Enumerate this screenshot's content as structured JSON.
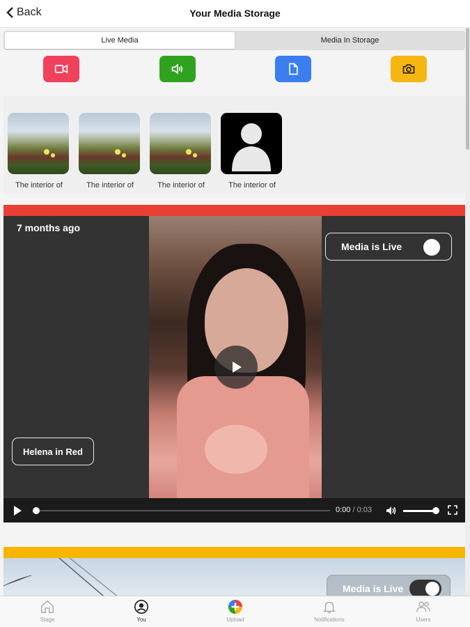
{
  "header": {
    "back_label": "Back",
    "title": "Your Media Storage"
  },
  "segment": {
    "live_label": "Live Media",
    "storage_label": "Media In Storage"
  },
  "media_types": [
    {
      "name": "video",
      "icon": "video-camera-icon",
      "color": "#f0415d"
    },
    {
      "name": "audio",
      "icon": "speaker-icon",
      "color": "#2fa31f"
    },
    {
      "name": "document",
      "icon": "document-icon",
      "color": "#3a7ef0"
    },
    {
      "name": "photo",
      "icon": "camera-icon",
      "color": "#f6b611"
    }
  ],
  "thumbnails": [
    {
      "caption": "The interior of",
      "kind": "landscape"
    },
    {
      "caption": "The interior of",
      "kind": "landscape"
    },
    {
      "caption": "The interior of",
      "kind": "landscape"
    },
    {
      "caption": "The interior of",
      "kind": "avatar"
    }
  ],
  "card1": {
    "accent": "#e84035",
    "time_ago": "7 months ago",
    "live_label": "Media is Live",
    "live_on": true,
    "name": "Helena in Red",
    "time_current": "0:00",
    "time_separator": "/",
    "time_total": "0:03",
    "progress": 0,
    "volume": 1
  },
  "card2": {
    "accent": "#f7b500",
    "live_label": "Media is Live",
    "live_on": true
  },
  "tabs": [
    {
      "label": "Stage",
      "icon": "home-icon",
      "active": false
    },
    {
      "label": "You",
      "icon": "user-icon",
      "active": true
    },
    {
      "label": "Upload",
      "icon": "upload-plus-icon",
      "active": false
    },
    {
      "label": "Notifications",
      "icon": "bell-icon",
      "active": false
    },
    {
      "label": "Users",
      "icon": "users-icon",
      "active": false
    }
  ]
}
